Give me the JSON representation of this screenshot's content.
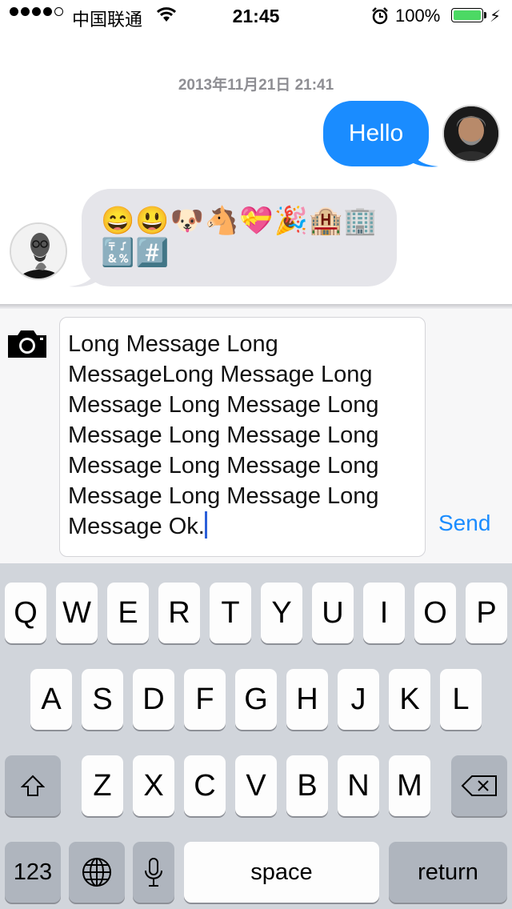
{
  "status_bar": {
    "carrier": "中国联通",
    "time": "21:45",
    "battery_percent": "100%",
    "signal_bars_filled": 4,
    "signal_bars_total": 5,
    "battery_level": 1.0,
    "battery_color": "#4cd964"
  },
  "conversation": {
    "timestamp": "2013年11月21日 21:41",
    "messages": [
      {
        "direction": "outgoing",
        "text": "Hello",
        "color": "#1a8cff"
      },
      {
        "direction": "incoming",
        "emoji_line_1": "😄😃🐶🐴💝🎉🏨🏢",
        "emoji_line_2": "🔣#️⃣",
        "color": "#e5e5ea"
      }
    ]
  },
  "compose": {
    "message_text": "Long Message Long\nMessageLong Message  Long\nMessage Long Message Long\nMessage Long Message Long\nMessage Long Message Long\nMessage Long Message Long\nMessage Ok.",
    "send_label": "Send",
    "camera_icon": "camera-icon"
  },
  "keyboard": {
    "row1": [
      "Q",
      "W",
      "E",
      "R",
      "T",
      "Y",
      "U",
      "I",
      "O",
      "P"
    ],
    "row2": [
      "A",
      "S",
      "D",
      "F",
      "G",
      "H",
      "J",
      "K",
      "L"
    ],
    "row3": [
      "Z",
      "X",
      "C",
      "V",
      "B",
      "N",
      "M"
    ],
    "numbers_label": "123",
    "space_label": "space",
    "return_label": "return",
    "shift_icon": "shift-icon",
    "delete_icon": "delete-icon",
    "globe_icon": "globe-icon",
    "mic_icon": "microphone-icon"
  },
  "colors": {
    "accent": "#1a8cff",
    "caret": "#2b5fd9",
    "keyboard_bg": "#d1d5db"
  }
}
